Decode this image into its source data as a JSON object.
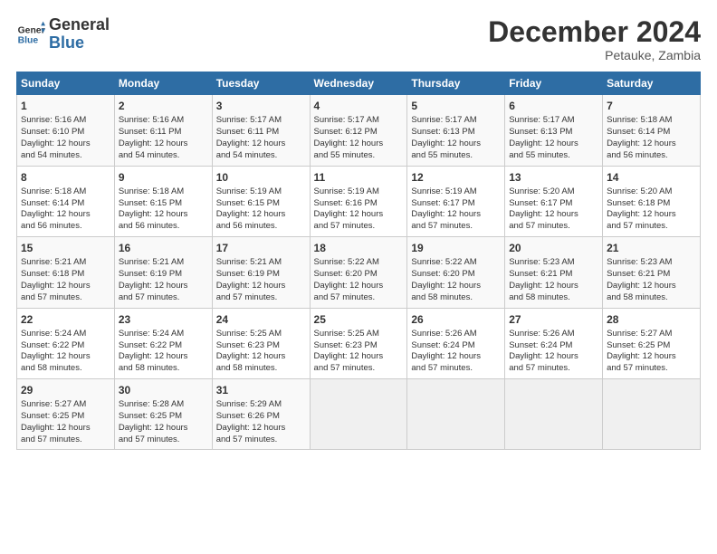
{
  "logo": {
    "line1": "General",
    "line2": "Blue"
  },
  "title": "December 2024",
  "location": "Petauke, Zambia",
  "days_of_week": [
    "Sunday",
    "Monday",
    "Tuesday",
    "Wednesday",
    "Thursday",
    "Friday",
    "Saturday"
  ],
  "weeks": [
    [
      {
        "day": "1",
        "lines": [
          "Sunrise: 5:16 AM",
          "Sunset: 6:10 PM",
          "Daylight: 12 hours",
          "and 54 minutes."
        ]
      },
      {
        "day": "2",
        "lines": [
          "Sunrise: 5:16 AM",
          "Sunset: 6:11 PM",
          "Daylight: 12 hours",
          "and 54 minutes."
        ]
      },
      {
        "day": "3",
        "lines": [
          "Sunrise: 5:17 AM",
          "Sunset: 6:11 PM",
          "Daylight: 12 hours",
          "and 54 minutes."
        ]
      },
      {
        "day": "4",
        "lines": [
          "Sunrise: 5:17 AM",
          "Sunset: 6:12 PM",
          "Daylight: 12 hours",
          "and 55 minutes."
        ]
      },
      {
        "day": "5",
        "lines": [
          "Sunrise: 5:17 AM",
          "Sunset: 6:13 PM",
          "Daylight: 12 hours",
          "and 55 minutes."
        ]
      },
      {
        "day": "6",
        "lines": [
          "Sunrise: 5:17 AM",
          "Sunset: 6:13 PM",
          "Daylight: 12 hours",
          "and 55 minutes."
        ]
      },
      {
        "day": "7",
        "lines": [
          "Sunrise: 5:18 AM",
          "Sunset: 6:14 PM",
          "Daylight: 12 hours",
          "and 56 minutes."
        ]
      }
    ],
    [
      {
        "day": "8",
        "lines": [
          "Sunrise: 5:18 AM",
          "Sunset: 6:14 PM",
          "Daylight: 12 hours",
          "and 56 minutes."
        ]
      },
      {
        "day": "9",
        "lines": [
          "Sunrise: 5:18 AM",
          "Sunset: 6:15 PM",
          "Daylight: 12 hours",
          "and 56 minutes."
        ]
      },
      {
        "day": "10",
        "lines": [
          "Sunrise: 5:19 AM",
          "Sunset: 6:15 PM",
          "Daylight: 12 hours",
          "and 56 minutes."
        ]
      },
      {
        "day": "11",
        "lines": [
          "Sunrise: 5:19 AM",
          "Sunset: 6:16 PM",
          "Daylight: 12 hours",
          "and 57 minutes."
        ]
      },
      {
        "day": "12",
        "lines": [
          "Sunrise: 5:19 AM",
          "Sunset: 6:17 PM",
          "Daylight: 12 hours",
          "and 57 minutes."
        ]
      },
      {
        "day": "13",
        "lines": [
          "Sunrise: 5:20 AM",
          "Sunset: 6:17 PM",
          "Daylight: 12 hours",
          "and 57 minutes."
        ]
      },
      {
        "day": "14",
        "lines": [
          "Sunrise: 5:20 AM",
          "Sunset: 6:18 PM",
          "Daylight: 12 hours",
          "and 57 minutes."
        ]
      }
    ],
    [
      {
        "day": "15",
        "lines": [
          "Sunrise: 5:21 AM",
          "Sunset: 6:18 PM",
          "Daylight: 12 hours",
          "and 57 minutes."
        ]
      },
      {
        "day": "16",
        "lines": [
          "Sunrise: 5:21 AM",
          "Sunset: 6:19 PM",
          "Daylight: 12 hours",
          "and 57 minutes."
        ]
      },
      {
        "day": "17",
        "lines": [
          "Sunrise: 5:21 AM",
          "Sunset: 6:19 PM",
          "Daylight: 12 hours",
          "and 57 minutes."
        ]
      },
      {
        "day": "18",
        "lines": [
          "Sunrise: 5:22 AM",
          "Sunset: 6:20 PM",
          "Daylight: 12 hours",
          "and 57 minutes."
        ]
      },
      {
        "day": "19",
        "lines": [
          "Sunrise: 5:22 AM",
          "Sunset: 6:20 PM",
          "Daylight: 12 hours",
          "and 58 minutes."
        ]
      },
      {
        "day": "20",
        "lines": [
          "Sunrise: 5:23 AM",
          "Sunset: 6:21 PM",
          "Daylight: 12 hours",
          "and 58 minutes."
        ]
      },
      {
        "day": "21",
        "lines": [
          "Sunrise: 5:23 AM",
          "Sunset: 6:21 PM",
          "Daylight: 12 hours",
          "and 58 minutes."
        ]
      }
    ],
    [
      {
        "day": "22",
        "lines": [
          "Sunrise: 5:24 AM",
          "Sunset: 6:22 PM",
          "Daylight: 12 hours",
          "and 58 minutes."
        ]
      },
      {
        "day": "23",
        "lines": [
          "Sunrise: 5:24 AM",
          "Sunset: 6:22 PM",
          "Daylight: 12 hours",
          "and 58 minutes."
        ]
      },
      {
        "day": "24",
        "lines": [
          "Sunrise: 5:25 AM",
          "Sunset: 6:23 PM",
          "Daylight: 12 hours",
          "and 58 minutes."
        ]
      },
      {
        "day": "25",
        "lines": [
          "Sunrise: 5:25 AM",
          "Sunset: 6:23 PM",
          "Daylight: 12 hours",
          "and 57 minutes."
        ]
      },
      {
        "day": "26",
        "lines": [
          "Sunrise: 5:26 AM",
          "Sunset: 6:24 PM",
          "Daylight: 12 hours",
          "and 57 minutes."
        ]
      },
      {
        "day": "27",
        "lines": [
          "Sunrise: 5:26 AM",
          "Sunset: 6:24 PM",
          "Daylight: 12 hours",
          "and 57 minutes."
        ]
      },
      {
        "day": "28",
        "lines": [
          "Sunrise: 5:27 AM",
          "Sunset: 6:25 PM",
          "Daylight: 12 hours",
          "and 57 minutes."
        ]
      }
    ],
    [
      {
        "day": "29",
        "lines": [
          "Sunrise: 5:27 AM",
          "Sunset: 6:25 PM",
          "Daylight: 12 hours",
          "and 57 minutes."
        ]
      },
      {
        "day": "30",
        "lines": [
          "Sunrise: 5:28 AM",
          "Sunset: 6:25 PM",
          "Daylight: 12 hours",
          "and 57 minutes."
        ]
      },
      {
        "day": "31",
        "lines": [
          "Sunrise: 5:29 AM",
          "Sunset: 6:26 PM",
          "Daylight: 12 hours",
          "and 57 minutes."
        ]
      },
      {
        "day": "",
        "lines": []
      },
      {
        "day": "",
        "lines": []
      },
      {
        "day": "",
        "lines": []
      },
      {
        "day": "",
        "lines": []
      }
    ]
  ]
}
